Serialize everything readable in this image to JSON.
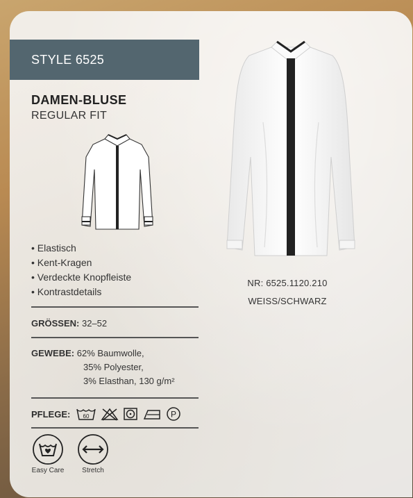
{
  "style_label": "STYLE 6525",
  "title": "DAMEN-BLUSE",
  "subtitle": "REGULAR FIT",
  "features": [
    "Elastisch",
    "Kent-Kragen",
    "Verdeckte Knopfleiste",
    "Kontrastdetails"
  ],
  "groessen": {
    "label": "GRÖSSEN:",
    "value": "32–52"
  },
  "gewebe": {
    "label": "GEWEBE:",
    "lines": [
      "62% Baumwolle,",
      "35% Polyester,",
      "3% Elasthan, 130 g/m²"
    ]
  },
  "pflege": {
    "label": "PFLEGE:",
    "wash_temp": "60",
    "icons": [
      "wash-60-icon",
      "no-bleach-icon",
      "tumble-dry-icon",
      "iron-icon",
      "professional-clean-p-icon"
    ],
    "p_symbol": "P"
  },
  "badges": [
    {
      "label": "Easy Care",
      "icon": "easy-care-icon"
    },
    {
      "label": "Stretch",
      "icon": "stretch-icon"
    }
  ],
  "product": {
    "nr": "NR: 6525.1120.210",
    "color": "WEISS/SCHWARZ"
  },
  "colors": {
    "bar": "#53666f",
    "card": "#f4f3f1",
    "placket": "#222222"
  }
}
